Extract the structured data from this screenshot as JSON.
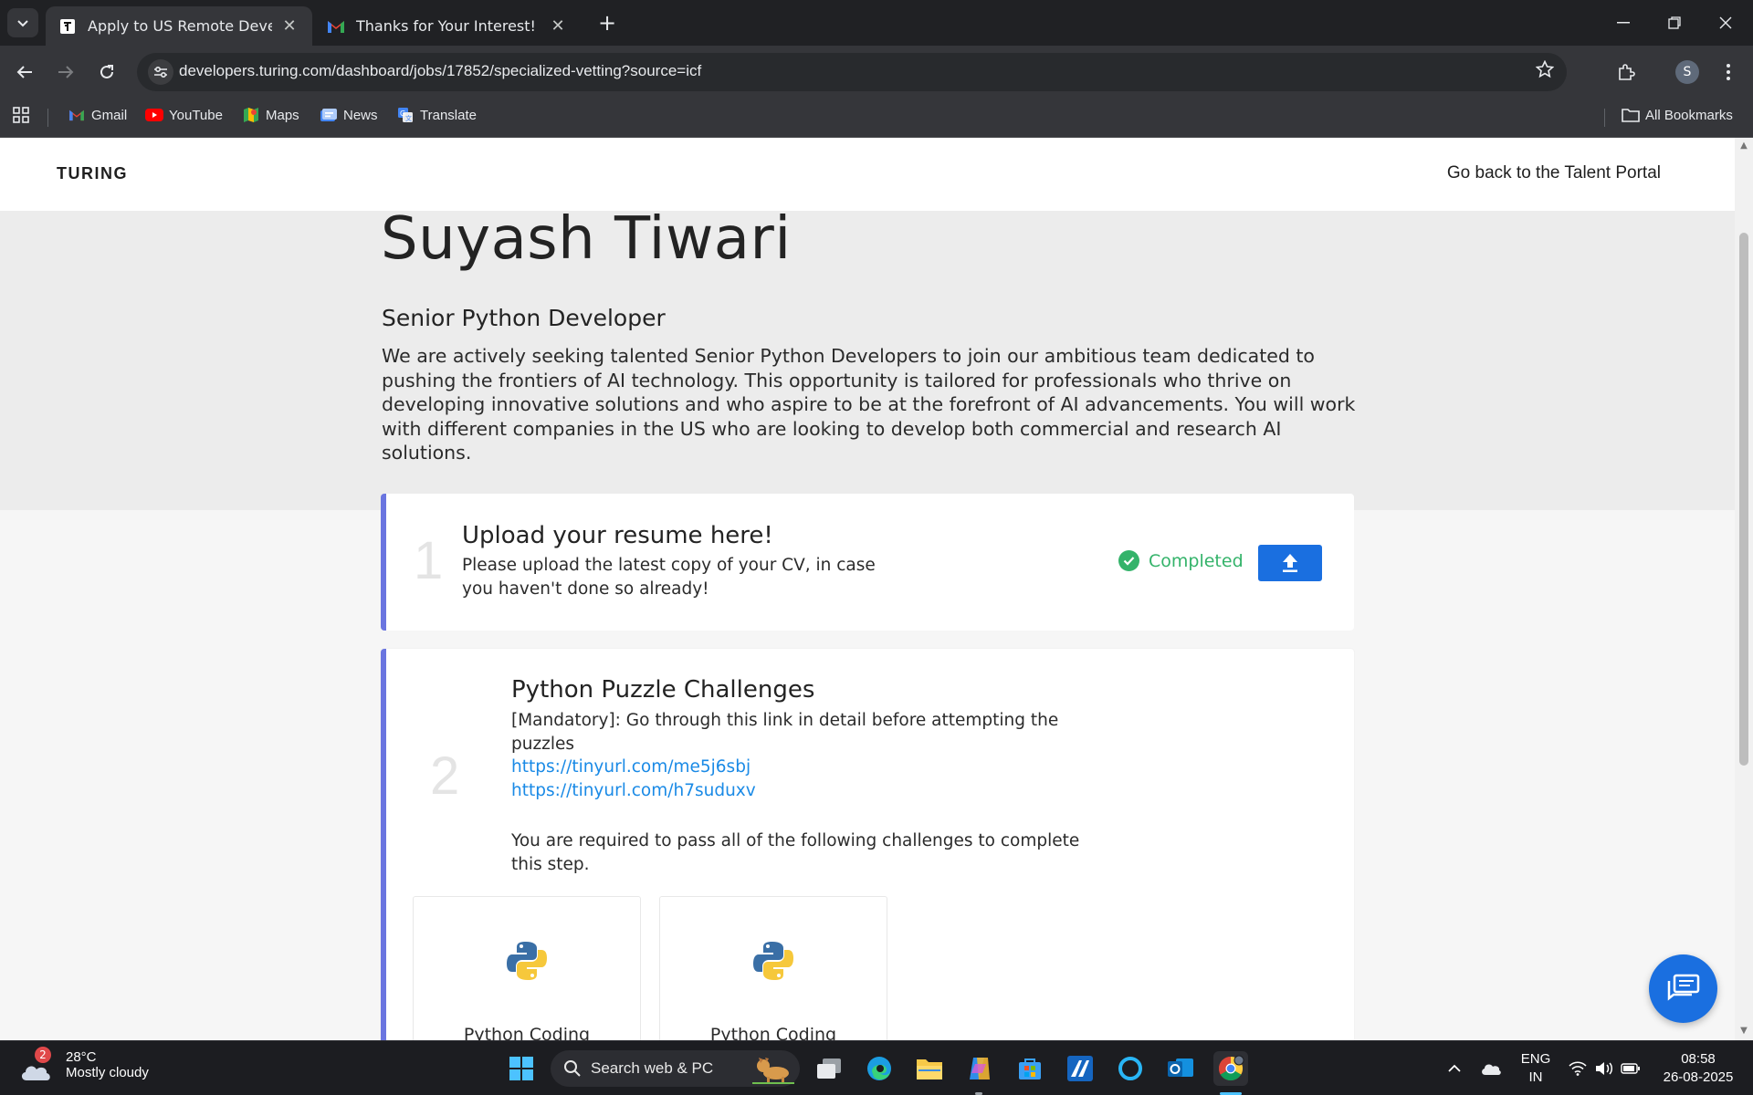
{
  "browser": {
    "tabs": [
      {
        "title": "Apply to US Remote Developer",
        "active": true
      },
      {
        "title": "Thanks for Your Interest! Next S",
        "active": false
      }
    ],
    "url": "developers.turing.com/dashboard/jobs/17852/specialized-vetting?source=icf",
    "profile_initial": "S",
    "bookmarks": [
      {
        "label": "Gmail",
        "icon": "gmail-icon"
      },
      {
        "label": "YouTube",
        "icon": "youtube-icon"
      },
      {
        "label": "Maps",
        "icon": "maps-icon"
      },
      {
        "label": "News",
        "icon": "news-icon"
      },
      {
        "label": "Translate",
        "icon": "translate-icon"
      }
    ],
    "all_bookmarks": "All Bookmarks"
  },
  "site": {
    "logo": "TURING",
    "back_link": "Go back to the Talent Portal"
  },
  "profile": {
    "name": "Suyash Tiwari",
    "role": "Senior Python Developer",
    "description": "We are actively seeking talented Senior Python Developers to join our ambitious team dedicated to pushing the frontiers of AI technology. This opportunity is tailored for professionals who thrive on developing innovative solutions and who aspire to be at the forefront of AI advancements. You will work with different companies in the US who are looking to develop both commercial and research AI solutions."
  },
  "steps": [
    {
      "number": "1",
      "title": "Upload your resume here!",
      "text": "Please upload the latest copy of your CV, in case you haven't done so already!",
      "status": "Completed"
    },
    {
      "number": "2",
      "title": "Python Puzzle Challenges",
      "text": "[Mandatory]: Go through this link in detail before attempting the puzzles",
      "links": [
        "https://tinyurl.com/me5j6sbj",
        "https://tinyurl.com/h7suduxv"
      ],
      "requirement": "You are required to pass all of the following challenges to complete this step.",
      "challenges": [
        {
          "title": "Python Coding"
        },
        {
          "title": "Python Coding"
        }
      ]
    }
  ],
  "taskbar": {
    "weather_temp": "28°C",
    "weather_cond": "Mostly cloudy",
    "weather_badge": "2",
    "search_placeholder": "Search web & PC",
    "lang_top": "ENG",
    "lang_bottom": "IN",
    "time": "08:58",
    "date": "26-08-2025"
  },
  "colors": {
    "accent_blue": "#1a6fe0",
    "step_border": "#6a75e0",
    "completed_green": "#34b36a",
    "link_blue": "#1a8ae6"
  }
}
